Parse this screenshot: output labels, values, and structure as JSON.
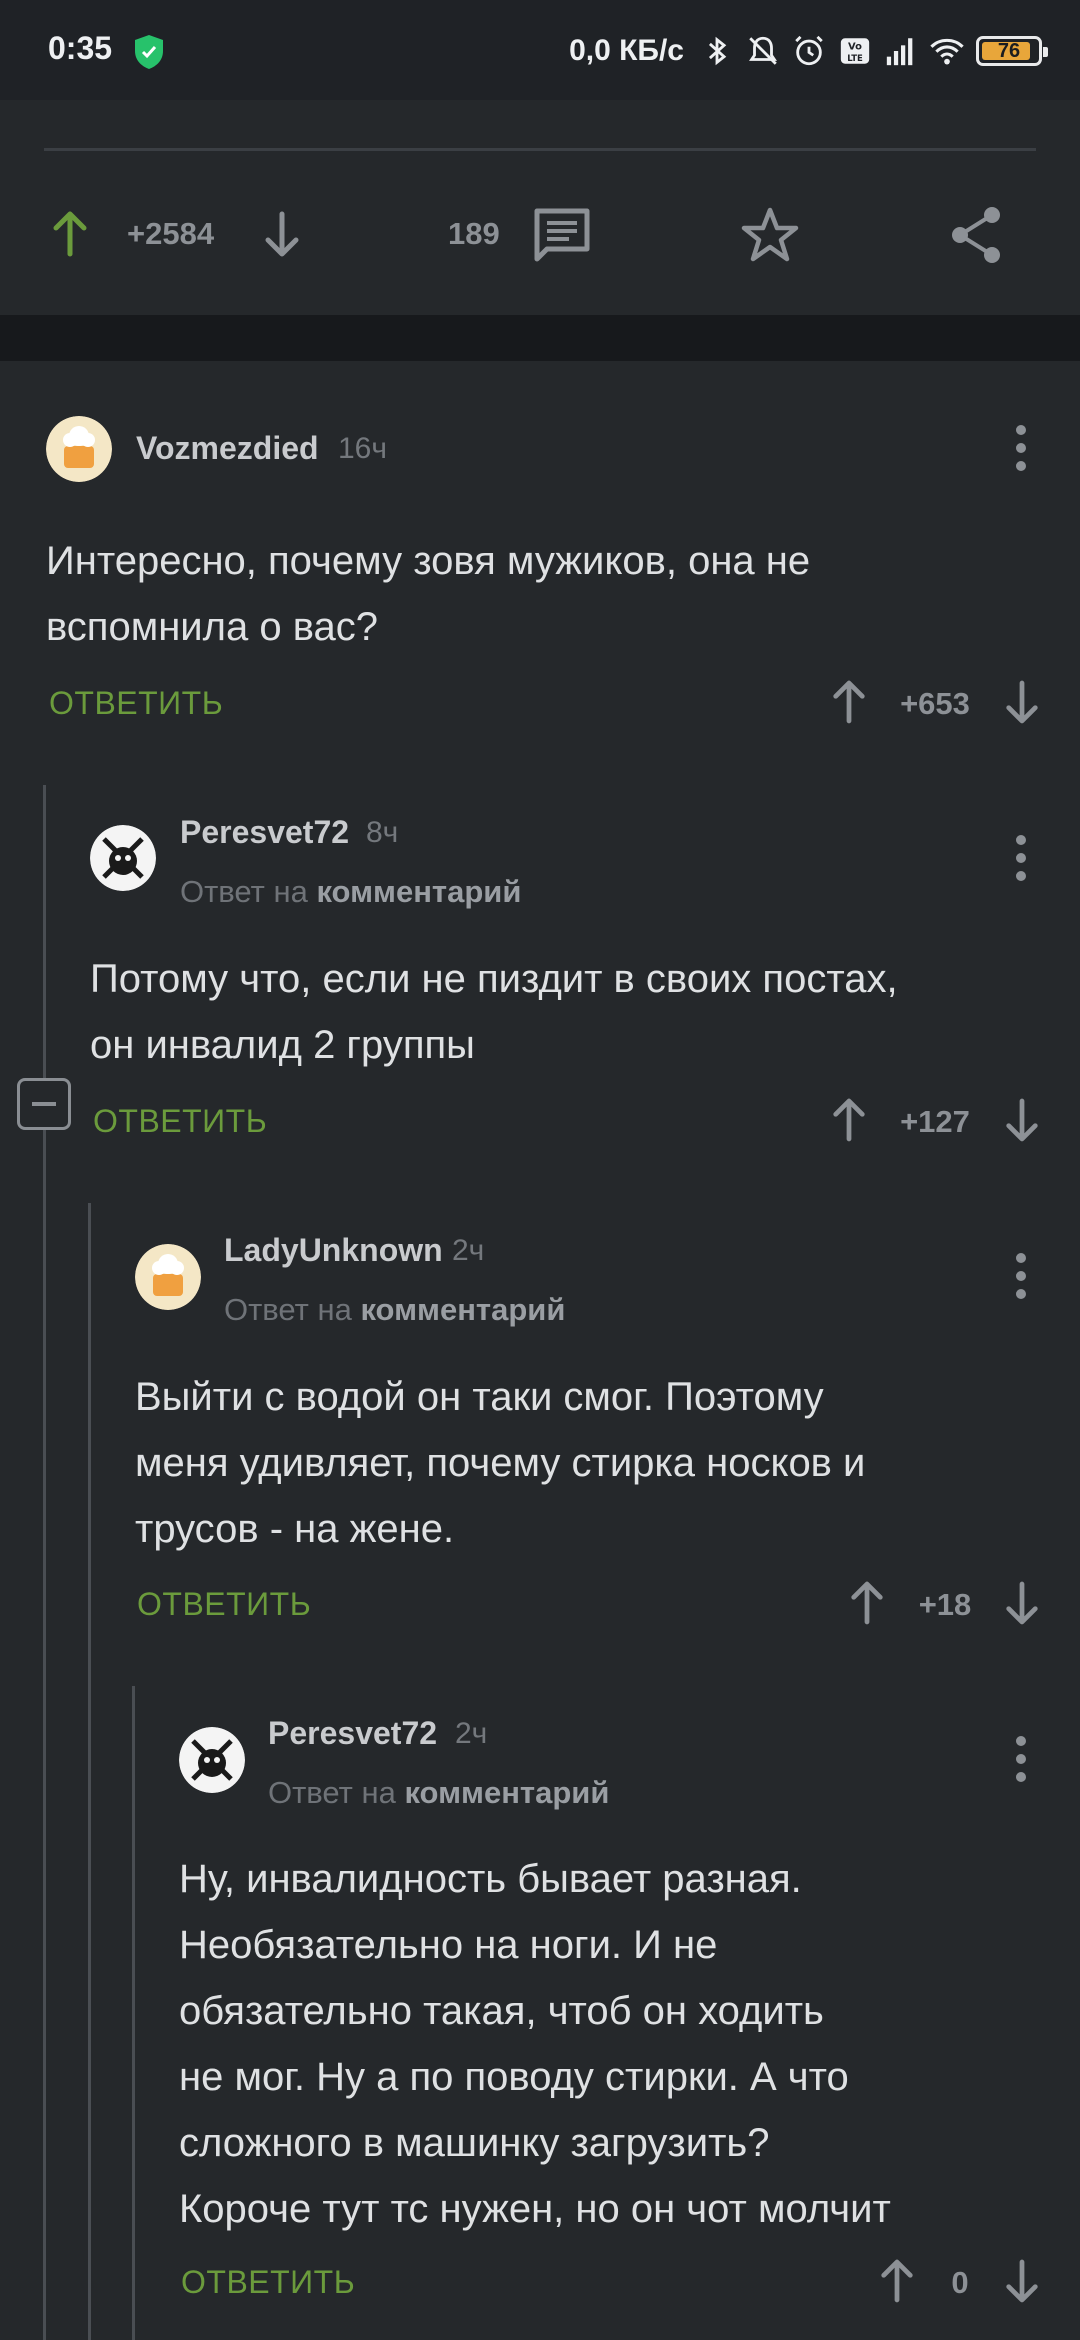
{
  "status_bar": {
    "time": "0:35",
    "net_speed": "0,0 КБ/с",
    "battery": "76",
    "icons": [
      "shield-icon",
      "bluetooth-icon",
      "mute-icon",
      "alarm-icon",
      "volte-icon",
      "signal-icon",
      "wifi-icon",
      "battery-icon"
    ]
  },
  "post": {
    "rating": "+2584",
    "comments_count": "189",
    "icons": [
      "arrow-up-icon",
      "arrow-down-icon",
      "comment-icon",
      "star-icon",
      "share-icon"
    ]
  },
  "comments": [
    {
      "user": "Vozmezdied",
      "time": "16ч",
      "reply_to": "",
      "text_lines": [
        "Интересно, почему зовя мужиков, она не",
        "вспомнила о вас?"
      ],
      "reply_label": "ОТВЕТИТЬ",
      "score": "+653"
    },
    {
      "user": "Peresvet72",
      "time": "8ч",
      "reply_to_prefix": "Ответ на",
      "reply_to_link": "комментарий",
      "text_lines": [
        "Потому что, если не пиздит в своих постах,",
        "он инвалид 2 группы"
      ],
      "reply_label": "ОТВЕТИТЬ",
      "score": "+127"
    },
    {
      "user": "LadyUnknown",
      "time": "2ч",
      "reply_to_prefix": "Ответ на",
      "reply_to_link": "комментарий",
      "text_lines": [
        "Выйти с водой он таки смог. Поэтому",
        "меня удивляет, почему стирка носков и",
        "трусов - на жене."
      ],
      "reply_label": "ОТВЕТИТЬ",
      "score": "+18"
    },
    {
      "user": "Peresvet72",
      "time": "2ч",
      "reply_to_prefix": "Ответ на",
      "reply_to_link": "комментарий",
      "text_lines": [
        "Ну, инвалидность бывает разная.",
        "Необязательно на ноги. И не",
        "обязательно такая, чтоб он ходить",
        "не мог. Ну а по поводу стирки. А что",
        "сложного в машинку загрузить?",
        "Короче тут тс нужен, но он чот молчит"
      ],
      "reply_label": "ОТВЕТИТЬ",
      "score": "0"
    }
  ],
  "colors": {
    "background": "#25282b",
    "accent_green": "#6b9b3c",
    "muted": "#8d9196"
  }
}
